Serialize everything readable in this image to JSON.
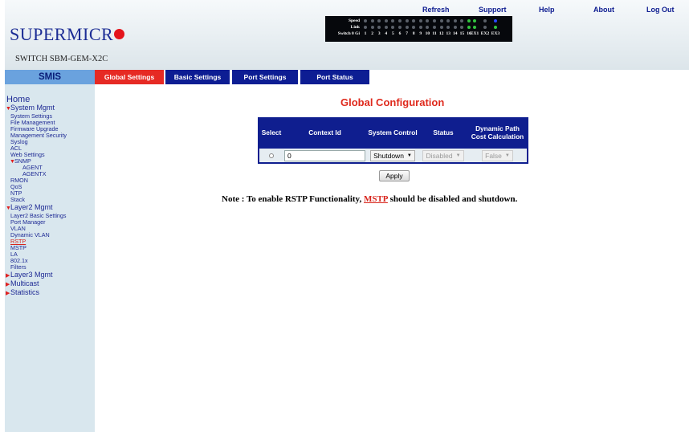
{
  "header": {
    "links": [
      "Refresh",
      "Support",
      "Help",
      "About",
      "Log Out"
    ],
    "logo_text": "SUPERMICR",
    "model": "SWITCH SBM-GEM-X2C",
    "port_panel": {
      "speed_label": "Speed",
      "link_label": "Link",
      "switch_label": "Switch 0 Gi",
      "port_numbers": [
        "1",
        "2",
        "3",
        "4",
        "5",
        "6",
        "7",
        "8",
        "9",
        "10",
        "11",
        "12",
        "13",
        "14",
        "15",
        "16",
        "EX1",
        "EX2",
        "EX3"
      ]
    }
  },
  "nav": {
    "sidebar_title": "SMIS",
    "tabs": [
      "Global Settings",
      "Basic Settings",
      "Port Settings",
      "Port Status"
    ],
    "active_tab": "Global Settings"
  },
  "sidebar": {
    "home": "Home",
    "system_mgmt": "System Mgmt",
    "system_items": [
      "System Settings",
      "File Management",
      "Firmware Upgrade",
      "Management Security",
      "Syslog",
      "ACL",
      "Web Settings"
    ],
    "snmp": "SNMP",
    "snmp_items": [
      "AGENT",
      "AGENTX"
    ],
    "system_items_2": [
      "RMON",
      "QoS",
      "NTP",
      "Stack"
    ],
    "layer2_mgmt": "Layer2 Mgmt",
    "layer2_items": [
      "Layer2 Basic Settings",
      "Port Manager",
      "VLAN",
      "Dynamic VLAN",
      "RSTP",
      "MSTP",
      "LA",
      "802.1x",
      "Filters"
    ],
    "current": "RSTP",
    "layer3_mgmt": "Layer3 Mgmt",
    "multicast": "Multicast",
    "statistics": "Statistics"
  },
  "main": {
    "title": "Global Configuration",
    "table": {
      "headers": [
        "Select",
        "Context Id",
        "System Control",
        "Status",
        "Dynamic Path Cost Calculation"
      ],
      "row": {
        "context_id": "0",
        "system_control": "Shutdown",
        "status": "Disabled",
        "dynamic_path": "False"
      }
    },
    "apply_label": "Apply",
    "note_before": "Note : To enable RSTP Functionality, ",
    "note_link": "MSTP",
    "note_after": " should be disabled and shutdown."
  }
}
